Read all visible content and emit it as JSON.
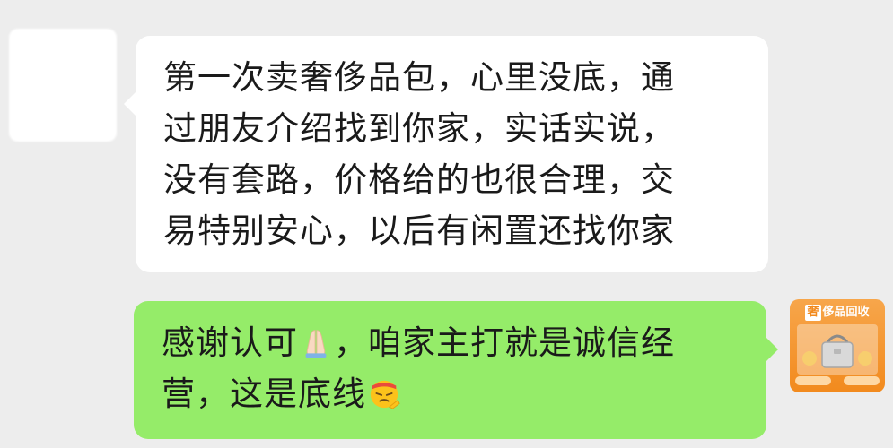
{
  "conversation": {
    "incoming": {
      "lines": [
        "第一次卖奢侈品包，心里没底，通",
        "过朋友介绍找到你家，实话实说，",
        "没有套路，价格给的也很合理，交",
        "易特别安心，以后有闲置还找你家"
      ]
    },
    "outgoing": {
      "line1_before": "感谢认可",
      "line1_after": "，咱家主打就是诚信经",
      "line2": "营，这是底线",
      "emojis": [
        "folded-hands-emoji",
        "saluting-face-emoji"
      ]
    }
  },
  "avatars": {
    "incoming_avatar": "blurred-avatar",
    "outgoing_avatar": {
      "header_lead": "奢",
      "header_rest": "侈品回收",
      "icon": "handbag-icon"
    }
  },
  "colors": {
    "background": "#ededed",
    "incoming_bubble": "#ffffff",
    "outgoing_bubble": "#95ec69",
    "avatar_orange": "#f28a1d"
  }
}
